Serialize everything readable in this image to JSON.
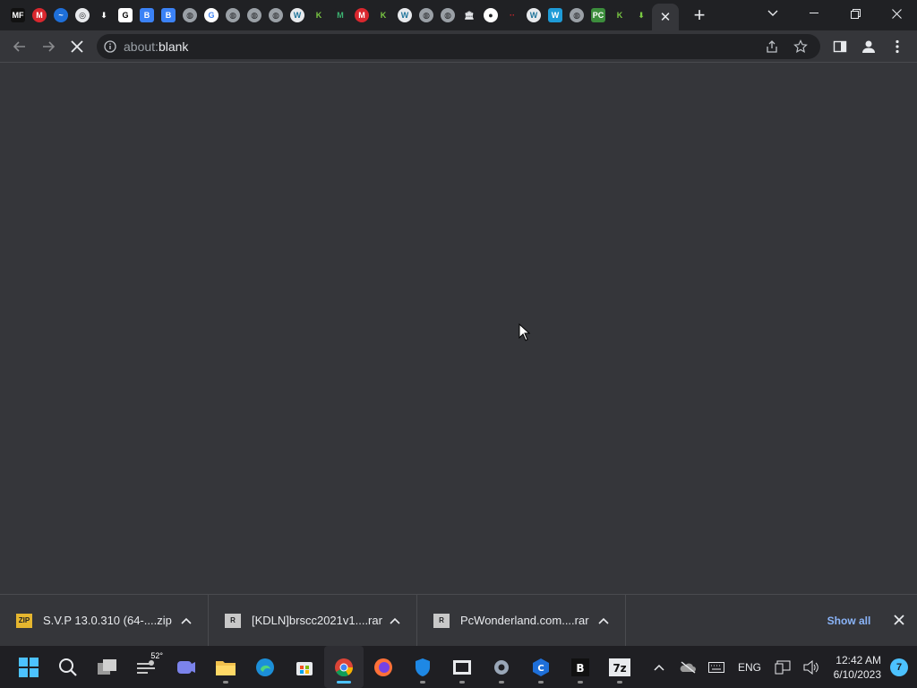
{
  "tabs": [
    {
      "icon": "mf-icon",
      "glyph": "MF",
      "bg": "#111111",
      "fg": "#ffffff"
    },
    {
      "icon": "mega-icon",
      "glyph": "M",
      "bg": "#d9272e",
      "fg": "#ffffff",
      "round": true
    },
    {
      "icon": "cloud-icon",
      "glyph": "~",
      "bg": "#1e6fd9",
      "fg": "#ffffff",
      "round": true
    },
    {
      "icon": "chrome-icon",
      "glyph": "◎",
      "bg": "#e8eaed",
      "fg": "#202124",
      "round": true
    },
    {
      "icon": "download-icon",
      "glyph": "⬇",
      "bg": "#202124",
      "fg": "#ffffff"
    },
    {
      "icon": "g-icon",
      "glyph": "G",
      "bg": "#ffffff",
      "fg": "#000000"
    },
    {
      "icon": "shield-b-icon",
      "glyph": "B",
      "bg": "#3b82f6",
      "fg": "#ffffff"
    },
    {
      "icon": "shield-b-icon",
      "glyph": "B",
      "bg": "#3b82f6",
      "fg": "#ffffff"
    },
    {
      "icon": "globe-icon",
      "glyph": "◍",
      "bg": "#9aa0a6",
      "fg": "#202124",
      "round": true
    },
    {
      "icon": "google-icon",
      "glyph": "G",
      "bg": "#ffffff",
      "fg": "#4285f4",
      "round": true
    },
    {
      "icon": "globe-icon",
      "glyph": "◍",
      "bg": "#9aa0a6",
      "fg": "#202124",
      "round": true
    },
    {
      "icon": "globe-icon",
      "glyph": "◍",
      "bg": "#9aa0a6",
      "fg": "#202124",
      "round": true
    },
    {
      "icon": "globe-icon",
      "glyph": "◍",
      "bg": "#9aa0a6",
      "fg": "#202124",
      "round": true
    },
    {
      "icon": "wordpress-icon",
      "glyph": "W",
      "bg": "#e8eaed",
      "fg": "#21759b",
      "round": true
    },
    {
      "icon": "k-icon",
      "glyph": "K",
      "bg": "#202124",
      "fg": "#7ac943"
    },
    {
      "icon": "m-icon",
      "glyph": "M",
      "bg": "#202124",
      "fg": "#3cb371"
    },
    {
      "icon": "mega-icon",
      "glyph": "M",
      "bg": "#d9272e",
      "fg": "#ffffff",
      "round": true
    },
    {
      "icon": "k-icon",
      "glyph": "K",
      "bg": "#202124",
      "fg": "#7ac943"
    },
    {
      "icon": "wordpress-icon",
      "glyph": "W",
      "bg": "#e8eaed",
      "fg": "#21759b",
      "round": true
    },
    {
      "icon": "globe-icon",
      "glyph": "◍",
      "bg": "#9aa0a6",
      "fg": "#202124",
      "round": true
    },
    {
      "icon": "globe-icon",
      "glyph": "◍",
      "bg": "#9aa0a6",
      "fg": "#202124",
      "round": true
    },
    {
      "icon": "bank-icon",
      "glyph": "🏛",
      "bg": "#202124",
      "fg": "#e8eaed"
    },
    {
      "icon": "github-icon",
      "glyph": "●",
      "bg": "#ffffff",
      "fg": "#202124",
      "round": true
    },
    {
      "icon": "dots-icon",
      "glyph": "··",
      "bg": "#202124",
      "fg": "#d9272e"
    },
    {
      "icon": "wordpress-icon",
      "glyph": "W",
      "bg": "#e8eaed",
      "fg": "#21759b",
      "round": true
    },
    {
      "icon": "w-icon",
      "glyph": "W",
      "bg": "#1e9bd7",
      "fg": "#ffffff"
    },
    {
      "icon": "globe-icon",
      "glyph": "◍",
      "bg": "#9aa0a6",
      "fg": "#202124",
      "round": true
    },
    {
      "icon": "pc-icon",
      "glyph": "PC",
      "bg": "#3c8d3c",
      "fg": "#ffffff"
    },
    {
      "icon": "k-icon",
      "glyph": "K",
      "bg": "#202124",
      "fg": "#7ac943"
    },
    {
      "icon": "download-green-icon",
      "glyph": "⬇",
      "bg": "#202124",
      "fg": "#7ac943"
    }
  ],
  "address_bar": {
    "scheme": "about:",
    "rest": "blank"
  },
  "downloads": [
    {
      "name": "S.V.P 13.0.310 (64-....zip",
      "icon": "zip-file-icon",
      "glyph": "ZIP",
      "color": "#e5b62f"
    },
    {
      "name": "[KDLN]brscc2021v1....rar",
      "icon": "rar-file-icon",
      "glyph": "R",
      "color": "#c8c8c8"
    },
    {
      "name": "PcWonderland.com....rar",
      "icon": "rar-file-icon",
      "glyph": "R",
      "color": "#c8c8c8"
    }
  ],
  "downloads_bar": {
    "show_all": "Show all"
  },
  "taskbar": {
    "weather_temp": "52°",
    "time": "12:42 AM",
    "date": "6/10/2023",
    "language": "ENG",
    "notifications": "7"
  }
}
